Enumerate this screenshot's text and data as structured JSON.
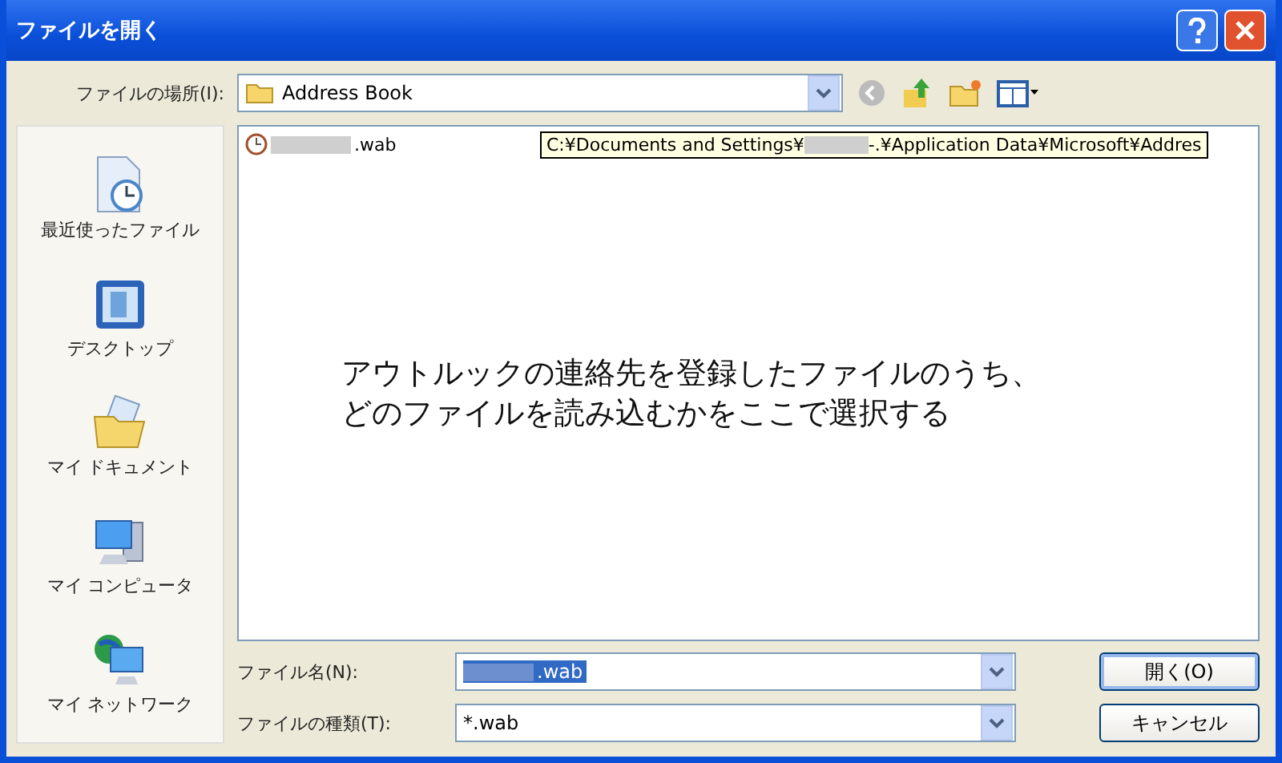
{
  "window": {
    "title": "ファイルを開く"
  },
  "location": {
    "label": "ファイルの場所(I):",
    "value": "Address Book"
  },
  "places": [
    {
      "kind": "recent",
      "label": "最近使ったファイル"
    },
    {
      "kind": "desktop",
      "label": "デスクトップ"
    },
    {
      "kind": "documents",
      "label": "マイ ドキュメント"
    },
    {
      "kind": "computer",
      "label": "マイ コンピュータ"
    },
    {
      "kind": "network",
      "label": "マイ ネットワーク"
    }
  ],
  "files": [
    {
      "name_suffix": ".wab"
    }
  ],
  "tooltip": {
    "start": "C:¥Documents and Settings¥",
    "end": "-.¥Application Data¥Microsoft¥Addres"
  },
  "annotation": [
    "アウトルックの連絡先を登録したファイルのうち、",
    "どのファイルを読み込むかをここで選択する"
  ],
  "filename": {
    "label": "ファイル名(N):",
    "value": ".wab"
  },
  "filetype": {
    "label": "ファイルの種類(T):",
    "value": "*.wab"
  },
  "buttons": [
    {
      "label": "開く(O)",
      "default": true
    },
    {
      "label": "キャンセル",
      "default": false
    }
  ]
}
